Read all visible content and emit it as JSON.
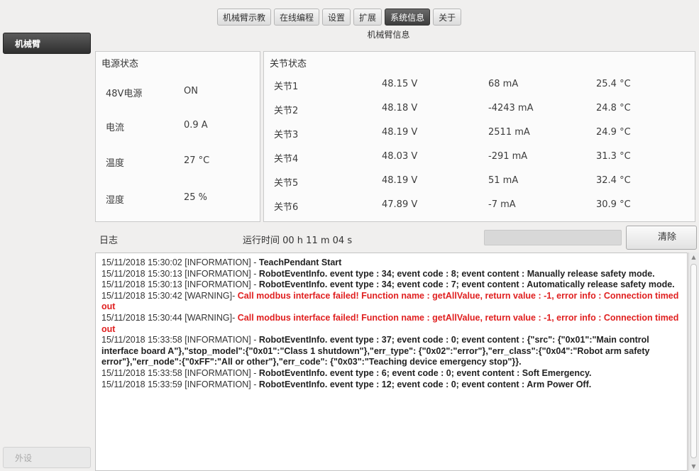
{
  "tabs": [
    {
      "label": "机械臂示教",
      "active": false
    },
    {
      "label": "在线编程",
      "active": false
    },
    {
      "label": "设置",
      "active": false
    },
    {
      "label": "扩展",
      "active": false
    },
    {
      "label": "系统信息",
      "active": true
    },
    {
      "label": "关于",
      "active": false
    }
  ],
  "section_title": "机械臂信息",
  "sidebar": {
    "active_label": "机械臂",
    "disabled_label": "外设"
  },
  "power": {
    "title": "电源状态",
    "rows": [
      {
        "key": "48V电源",
        "value": "ON"
      },
      {
        "key": "电流",
        "value": "0.9 A"
      },
      {
        "key": "温度",
        "value": "27 °C"
      },
      {
        "key": "湿度",
        "value": "25 %"
      }
    ]
  },
  "joints": {
    "title": "关节状态",
    "rows": [
      {
        "name": "关节1",
        "voltage": "48.15 V",
        "current": "68 mA",
        "temp": "25.4 °C"
      },
      {
        "name": "关节2",
        "voltage": "48.18 V",
        "current": "-4243 mA",
        "temp": "24.8 °C"
      },
      {
        "name": "关节3",
        "voltage": "48.19 V",
        "current": "2511 mA",
        "temp": "24.9 °C"
      },
      {
        "name": "关节4",
        "voltage": "48.03 V",
        "current": "-291 mA",
        "temp": "31.3 °C"
      },
      {
        "name": "关节5",
        "voltage": "48.19 V",
        "current": "51 mA",
        "temp": "32.4 °C"
      },
      {
        "name": "关节6",
        "voltage": "47.89 V",
        "current": "-7 mA",
        "temp": "30.9 °C"
      }
    ]
  },
  "log": {
    "label": "日志",
    "runtime": "运行时间 00 h 11 m 04 s",
    "progress": 0,
    "clear_label": "清除",
    "entries": [
      {
        "prefix": "15/11/2018 15:30:02 [INFORMATION] - ",
        "message": "TeachPendant Start",
        "level": "info"
      },
      {
        "prefix": "15/11/2018 15:30:13 [INFORMATION] - ",
        "message": "RobotEventInfo. event type : 34; event code : 8; event content : Manually release safety mode.",
        "level": "info"
      },
      {
        "prefix": "15/11/2018 15:30:13 [INFORMATION] - ",
        "message": "RobotEventInfo. event type : 34; event code : 7; event content : Automatically release safety mode.",
        "level": "info"
      },
      {
        "prefix": "15/11/2018 15:30:42 [WARNING]- ",
        "message": "Call modbus interface failed! Function name : getAllValue, return value : -1, error info : Connection timed out",
        "level": "warn"
      },
      {
        "prefix": "15/11/2018 15:30:44 [WARNING]- ",
        "message": "Call modbus interface failed! Function name : getAllValue, return value : -1, error info : Connection timed out",
        "level": "warn"
      },
      {
        "prefix": "15/11/2018 15:33:58 [INFORMATION] - ",
        "message": "RobotEventInfo. event type : 37; event code : 0; event content : {\"src\": {\"0x01\":\"Main control interface board A\"},\"stop_model\":{\"0x01\":\"Class 1 shutdown\"},\"err_type\": {\"0x02\":\"error\"},\"err_class\":{\"0x04\":\"Robot arm safety error\"},\"err_node\":{\"0xFF\":\"All or other\"},\"err_code\": {\"0x03\":\"Teaching device emergency stop\"}}.",
        "level": "info"
      },
      {
        "prefix": "15/11/2018 15:33:58 [INFORMATION] - ",
        "message": "RobotEventInfo. event type : 6; event code : 0; event content : Soft Emergency.",
        "level": "info"
      },
      {
        "prefix": "15/11/2018 15:33:59 [INFORMATION] - ",
        "message": "RobotEventInfo. event type : 12; event code : 0; event content : Arm Power Off.",
        "level": "info"
      }
    ]
  }
}
